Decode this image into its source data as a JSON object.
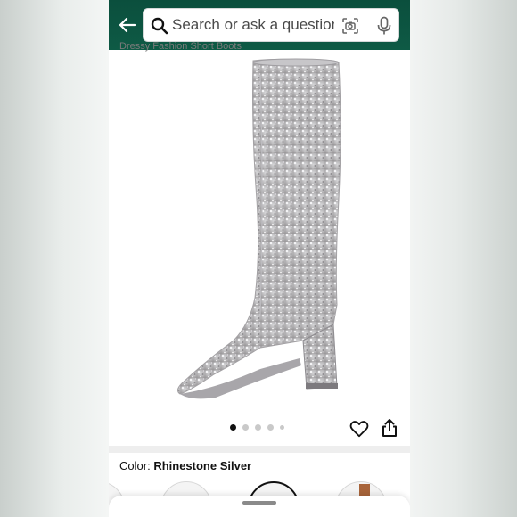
{
  "search": {
    "placeholder": "Search or ask a question"
  },
  "product": {
    "subtitle": "Dressy Fashion Short Boots",
    "image_description_icon": "rhinestone-knee-high-boot",
    "carousel": {
      "total_dots": 5,
      "active_index": 0
    }
  },
  "variation": {
    "label": "Color:",
    "selected_value": "Rhinestone Silver"
  },
  "colors": {
    "header_bg": "#0e5a45",
    "accent": "#111111"
  }
}
